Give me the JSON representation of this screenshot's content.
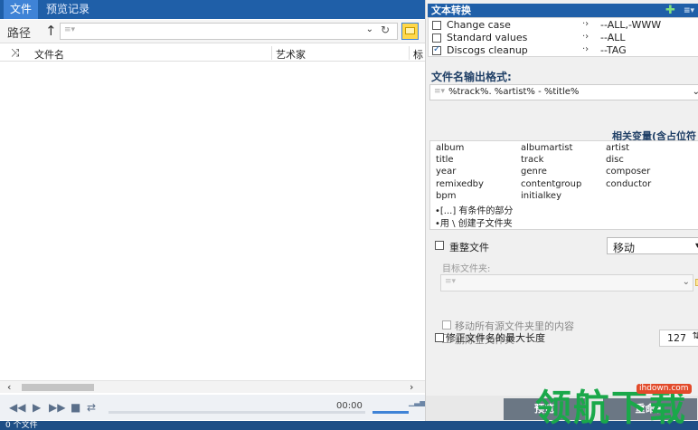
{
  "tabs": [
    {
      "label": "文件"
    },
    {
      "label": "预览记录"
    }
  ],
  "path": {
    "label": "路径",
    "value": ""
  },
  "columns": {
    "filename": "文件名",
    "artist": "艺术家",
    "title_truncated": "标"
  },
  "player": {
    "time": "00:00"
  },
  "status": {
    "text": "0 个文件"
  },
  "text_replace": {
    "header": "文本转换",
    "rules": [
      {
        "name": "Change case",
        "checked": false,
        "value": "--ALL,-WWW"
      },
      {
        "name": "Standard values",
        "checked": false,
        "value": "--ALL"
      },
      {
        "name": "Discogs cleanup",
        "checked": true,
        "value": "--TAG"
      }
    ]
  },
  "format": {
    "label": "文件名输出格式:",
    "value": "%track%. %artist% - %title%"
  },
  "variables": {
    "title": "相关变量(含占位符",
    "items": [
      [
        "album",
        "albumartist",
        "artist"
      ],
      [
        "title",
        "track",
        "disc"
      ],
      [
        "year",
        "genre",
        "composer"
      ],
      [
        "remixedby",
        "contentgroup",
        "conductor"
      ],
      [
        "bpm",
        "initialkey",
        ""
      ]
    ],
    "notes": [
      "•[...] 有条件的部分",
      "•用 \\ 创建子文件夹"
    ]
  },
  "reorganize": {
    "label": "重整文件",
    "mode": "移动",
    "target_label": "目标文件夹:",
    "move_all": "移动所有源文件夹里的内容",
    "delete_empty": "删除空文件夹"
  },
  "max_length": {
    "label": "修正文件名的最大长度",
    "value": "127"
  },
  "buttons": {
    "preview": "预览",
    "rename": "重命名"
  },
  "watermark": {
    "site": "ihdown.com",
    "text": "领航下载"
  }
}
